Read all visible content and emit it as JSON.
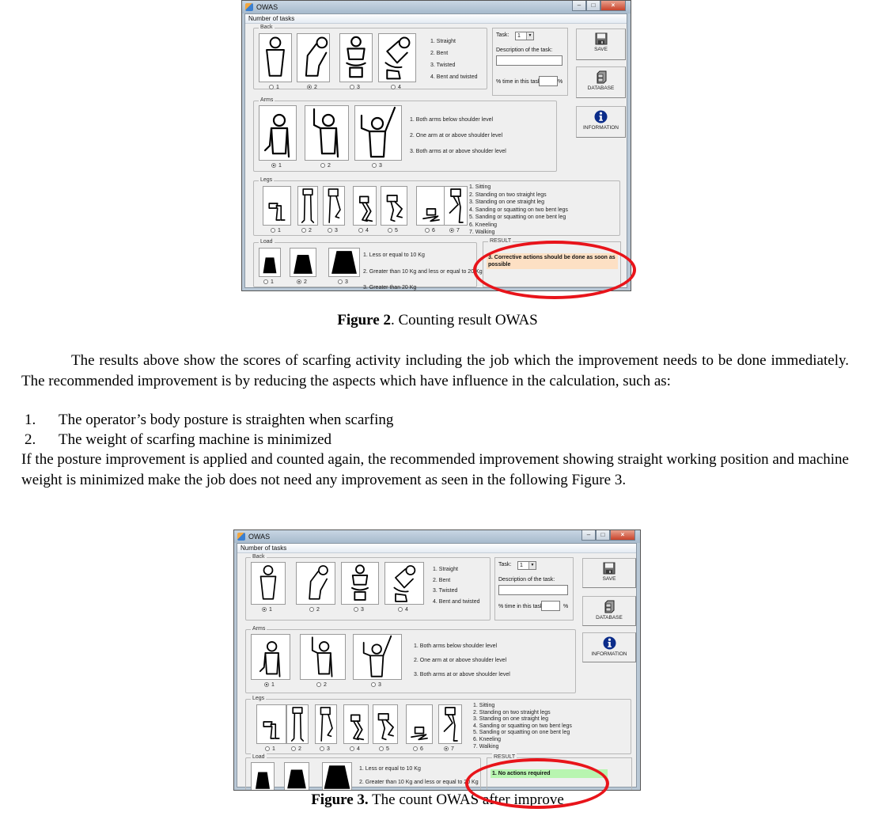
{
  "app": {
    "window_title": "OWAS",
    "menu_label": "Number of tasks",
    "window_buttons": [
      "minimize",
      "maximize",
      "close"
    ]
  },
  "back": {
    "legend": "Back",
    "options": [
      "1. Straight",
      "2. Bent",
      "3. Twisted",
      "4. Bent and twisted"
    ],
    "radio_labels": [
      "1",
      "2",
      "3",
      "4"
    ]
  },
  "arms": {
    "legend": "Arms",
    "options": [
      "1. Both arms below shoulder level",
      "2. One arm at or above shoulder level",
      "3. Both arms at or above shoulder level"
    ],
    "radio_labels": [
      "1",
      "2",
      "3"
    ]
  },
  "legs": {
    "legend": "Legs",
    "options": [
      "1. Sitting",
      "2. Standing on two straight legs",
      "3. Standing on one straight leg",
      "4. Sanding or squatting on two bent legs",
      "5. Sanding or squatting on one bent leg",
      "6. Kneeling",
      "7. Walking"
    ],
    "radio_labels": [
      "1",
      "2",
      "3",
      "4",
      "5",
      "6",
      "7"
    ]
  },
  "load": {
    "legend": "Load",
    "options": [
      "1. Less or equal to 10 Kg",
      "2. Greater than 10 Kg and less or equal to 20 Kg",
      "3. Greater than 20 Kg"
    ],
    "radio_labels": [
      "1",
      "2",
      "3"
    ]
  },
  "task_panel": {
    "task_label": "Task:",
    "task_value": "1",
    "description_label": "Description of the task:",
    "description_value": "",
    "time_label": "% time in this task:",
    "time_value": "",
    "percent_sign": "%"
  },
  "buttons": {
    "save": "SAVE",
    "database": "DATABASE",
    "information": "INFORMATION"
  },
  "result_legend": "RESULT",
  "figure2": {
    "selected": {
      "back": 2,
      "arms": 1,
      "legs": 7,
      "load": 2
    },
    "result_text": "3. Corrective actions should be done as soon as possible",
    "result_color": "#fde0c4",
    "caption_bold": "Figure 2",
    "caption_rest": ". Counting result OWAS"
  },
  "figure3": {
    "selected": {
      "back": 1,
      "arms": 1,
      "legs": 7,
      "load": 1
    },
    "result_text": "1. No actions required",
    "result_color": "#b8f5b0",
    "caption_bold": "Figure 3.",
    "caption_rest": " The count OWAS after improve"
  },
  "annotation_color": "#e8141a",
  "body": {
    "paragraph1": "The results above show the scores of scarfing activity including the job which the improvement needs to be done immediately. The recommended improvement is by reducing the aspects which have influence in the calculation, such as:",
    "list": [
      {
        "num": "1.",
        "text": "The operator’s body posture is straighten when scarfing"
      },
      {
        "num": "2.",
        "text": "The weight of scarfing machine is minimized"
      }
    ],
    "paragraph2": "If the posture improvement is applied and counted again, the recommended improvement showing straight working position and machine weight is minimized make the job does not need any improvement as seen in the following Figure 3."
  }
}
